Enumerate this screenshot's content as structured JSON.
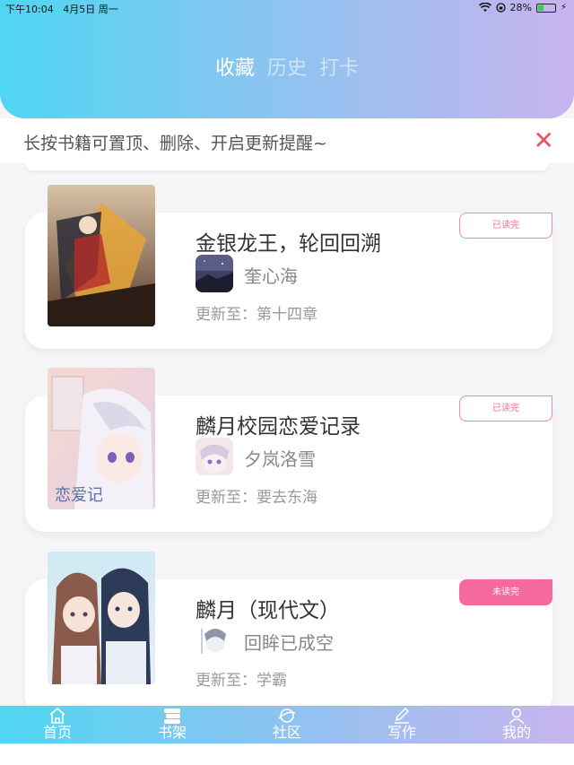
{
  "status_bar": {
    "time": "下午10:04",
    "date": "4月5日 周一",
    "battery": "28%",
    "battery_level": 0.28
  },
  "header": {
    "tabs": [
      {
        "label": "收藏",
        "active": true
      },
      {
        "label": "历史",
        "active": false
      },
      {
        "label": "打卡",
        "active": false
      }
    ]
  },
  "notice": {
    "text": "长按书籍可置顶、删除、开启更新提醒~",
    "close_icon": "close-icon"
  },
  "books": [
    {
      "title": "金银龙王，轮回回溯",
      "author": "奎心海",
      "update_prefix": "更新至：",
      "update_chapter": "第十四章",
      "badge": "已读完",
      "badge_filled": false
    },
    {
      "title": "麟月校园恋爱记录",
      "author": "夕岚洛雪",
      "update_prefix": "更新至：",
      "update_chapter": "要去东海",
      "badge": "已读完",
      "badge_filled": false
    },
    {
      "title": "麟月（现代文）",
      "author": "回眸已成空",
      "update_prefix": "更新至：",
      "update_chapter": "学霸",
      "badge": "未读完",
      "badge_filled": true
    }
  ],
  "tabbar": [
    {
      "label": "首页",
      "icon": "home-icon"
    },
    {
      "label": "书架",
      "icon": "bookshelf-icon"
    },
    {
      "label": "社区",
      "icon": "community-icon"
    },
    {
      "label": "写作",
      "icon": "write-icon"
    },
    {
      "label": "我的",
      "icon": "profile-icon"
    }
  ],
  "colors": {
    "gradient_start": "#4fd6f3",
    "gradient_end": "#c8b4ee",
    "accent_pink": "#f56a9d",
    "close_red": "#f0505f"
  }
}
